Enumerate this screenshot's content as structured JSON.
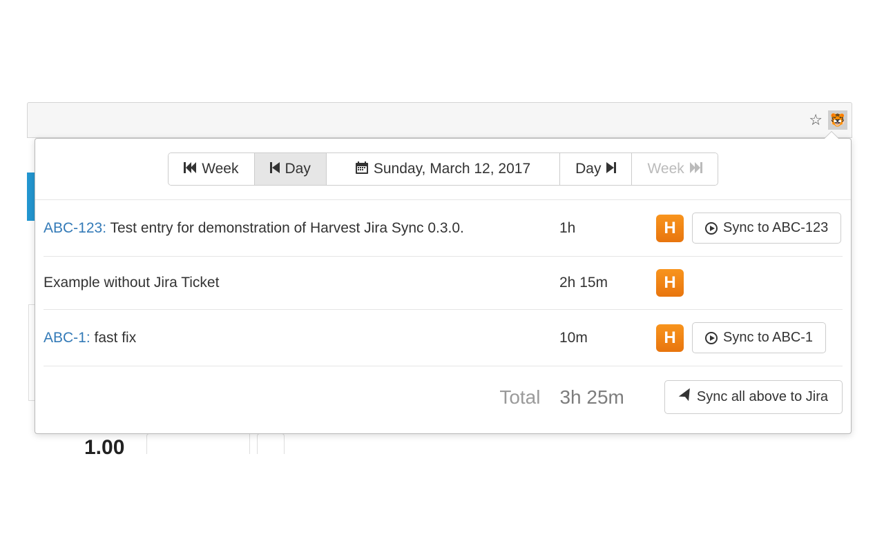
{
  "browser": {
    "ext_glyph": "🐯"
  },
  "nav": {
    "prev_week": "Week",
    "prev_day": "Day",
    "date": "Sunday, March 12, 2017",
    "next_day": "Day",
    "next_week": "Week"
  },
  "entries": [
    {
      "ticket": "ABC-123:",
      "desc": " Test entry for demonstration of Harvest Jira Sync 0.3.0.",
      "time": "1h",
      "sync_label": "Sync to ABC-123",
      "has_sync": true
    },
    {
      "ticket": "",
      "desc": "Example without Jira Ticket",
      "time": "2h 15m",
      "sync_label": "",
      "has_sync": false
    },
    {
      "ticket": "ABC-1:",
      "desc": " fast fix",
      "time": "10m",
      "sync_label": "Sync to ABC-1",
      "has_sync": true
    }
  ],
  "footer": {
    "total_label": "Total",
    "total_value": "3h 25m",
    "sync_all": "Sync all above to Jira"
  },
  "bg": {
    "timer": "1.00"
  },
  "badge": {
    "letter": "H"
  }
}
